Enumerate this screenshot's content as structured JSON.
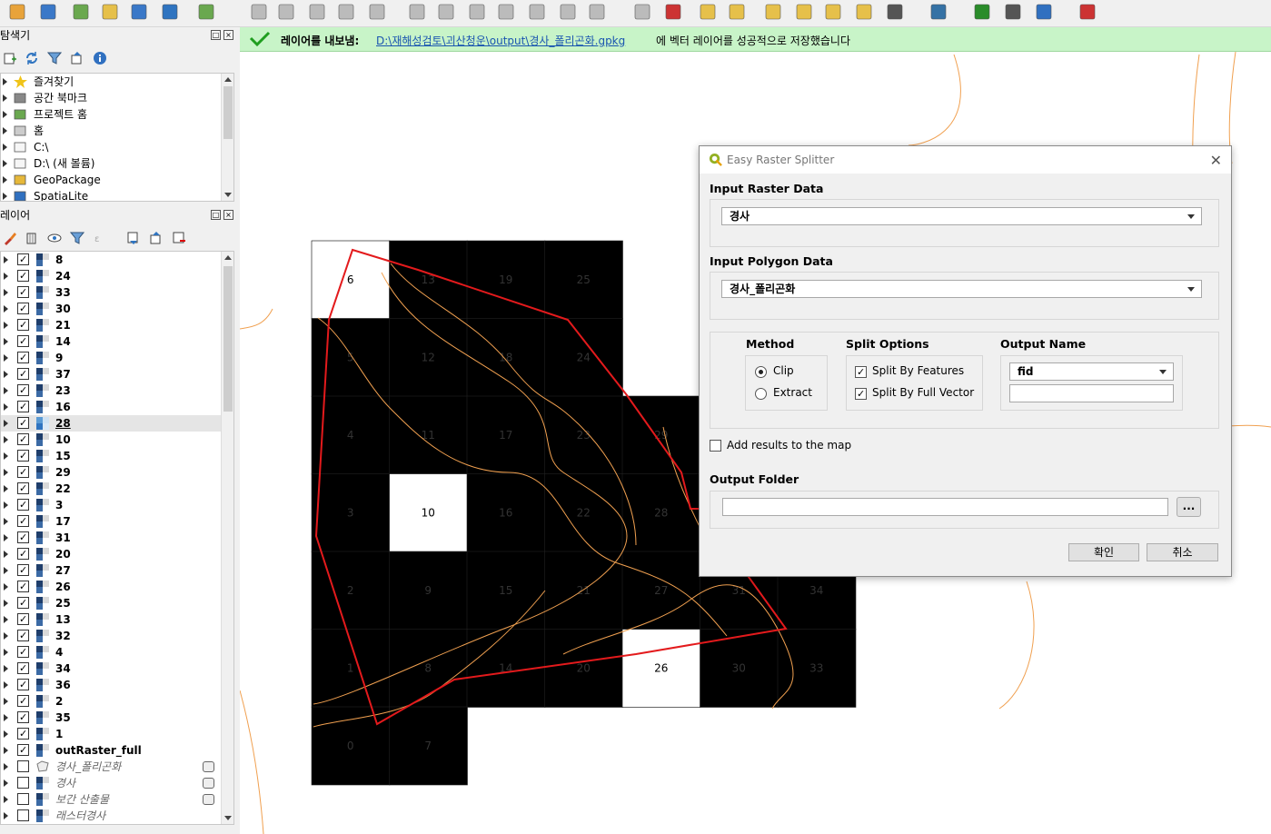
{
  "toolbar": {
    "icons": [
      "open-data-source-manager-icon",
      "new-geopackage-layer-icon",
      "new-shapefile-layer-icon",
      "digitize-icon",
      "new-spatialite-icon",
      "new-virtual-layer-icon",
      "vector-tools-icon",
      "edit-pencil-icon",
      "toggle-editing-icon",
      "save-edits-icon",
      "add-feature-icon",
      "vertex-tool-icon",
      "modify-attributes-icon",
      "delete-selected-icon",
      "cut-features-icon",
      "copy-features-icon",
      "paste-features-icon",
      "undo-icon",
      "redo-icon",
      "label-toolbar-icon",
      "label-pin-icon",
      "label-abc-icon",
      "label-highlight-icon",
      "label-show-icon",
      "label-move-icon",
      "label-rotate-icon",
      "label-change-icon",
      "plugin-globe-icon",
      "python-console-icon",
      "profile-tool-icon",
      "georeferencer-icon",
      "help-icon",
      "crosshair-icon"
    ]
  },
  "browser": {
    "title": "탐색기",
    "items": [
      {
        "label": "즐겨찾기",
        "icon": "star-icon"
      },
      {
        "label": "공간 북마크",
        "icon": "bookmark-icon"
      },
      {
        "label": "프로젝트 홈",
        "icon": "project-home-icon"
      },
      {
        "label": "홈",
        "icon": "home-folder-icon"
      },
      {
        "label": "C:\\",
        "icon": "drive-folder-icon"
      },
      {
        "label": "D:\\ (새 볼륨)",
        "icon": "drive-folder-icon"
      },
      {
        "label": "GeoPackage",
        "icon": "geopackage-icon"
      },
      {
        "label": "SpatiaLite",
        "icon": "spatialite-icon"
      }
    ]
  },
  "layers": {
    "title": "레이어",
    "items": [
      {
        "label": "8",
        "checked": true,
        "style": "raster"
      },
      {
        "label": "24",
        "checked": true,
        "style": "raster"
      },
      {
        "label": "33",
        "checked": true,
        "style": "raster"
      },
      {
        "label": "30",
        "checked": true,
        "style": "raster"
      },
      {
        "label": "21",
        "checked": true,
        "style": "raster"
      },
      {
        "label": "14",
        "checked": true,
        "style": "raster"
      },
      {
        "label": "9",
        "checked": true,
        "style": "raster"
      },
      {
        "label": "37",
        "checked": true,
        "style": "raster"
      },
      {
        "label": "23",
        "checked": true,
        "style": "raster"
      },
      {
        "label": "16",
        "checked": true,
        "style": "raster"
      },
      {
        "label": "28",
        "checked": true,
        "style": "raster",
        "selected": true
      },
      {
        "label": "10",
        "checked": true,
        "style": "raster"
      },
      {
        "label": "15",
        "checked": true,
        "style": "raster"
      },
      {
        "label": "29",
        "checked": true,
        "style": "raster"
      },
      {
        "label": "22",
        "checked": true,
        "style": "raster"
      },
      {
        "label": "3",
        "checked": true,
        "style": "raster"
      },
      {
        "label": "17",
        "checked": true,
        "style": "raster"
      },
      {
        "label": "31",
        "checked": true,
        "style": "raster"
      },
      {
        "label": "20",
        "checked": true,
        "style": "raster"
      },
      {
        "label": "27",
        "checked": true,
        "style": "raster"
      },
      {
        "label": "26",
        "checked": true,
        "style": "raster"
      },
      {
        "label": "25",
        "checked": true,
        "style": "raster"
      },
      {
        "label": "13",
        "checked": true,
        "style": "raster"
      },
      {
        "label": "32",
        "checked": true,
        "style": "raster"
      },
      {
        "label": "4",
        "checked": true,
        "style": "raster"
      },
      {
        "label": "34",
        "checked": true,
        "style": "raster"
      },
      {
        "label": "36",
        "checked": true,
        "style": "raster"
      },
      {
        "label": "2",
        "checked": true,
        "style": "raster"
      },
      {
        "label": "35",
        "checked": true,
        "style": "raster"
      },
      {
        "label": "1",
        "checked": true,
        "style": "raster"
      },
      {
        "label": "outRaster_full",
        "checked": true,
        "style": "raster"
      },
      {
        "label": "경사_폴리곤화",
        "checked": false,
        "style": "polygon-ital"
      },
      {
        "label": "경사",
        "checked": false,
        "style": "raster-ital"
      },
      {
        "label": "보간 산출물",
        "checked": false,
        "style": "raster-ital"
      },
      {
        "label": "래스터경사",
        "checked": false,
        "style": "raster-ital"
      }
    ]
  },
  "message": {
    "title": "레이어를 내보냄:",
    "path": "D:\\재해성검토\\괴산청운\\output\\경사_폴리곤화.gpkg",
    "rest": "에 벡터 레이어를 성공적으로 저장했습니다"
  },
  "map": {
    "white_cells": [
      "6",
      "10",
      "26"
    ],
    "cell_labels": [
      {
        "label": "6",
        "col": 0,
        "row": 0
      },
      {
        "label": "13",
        "col": 1,
        "row": 0
      },
      {
        "label": "19",
        "col": 2,
        "row": 0
      },
      {
        "label": "25",
        "col": 3,
        "row": 0
      },
      {
        "label": "5",
        "col": 0,
        "row": 1
      },
      {
        "label": "12",
        "col": 1,
        "row": 1
      },
      {
        "label": "18",
        "col": 2,
        "row": 1
      },
      {
        "label": "24",
        "col": 3,
        "row": 1
      },
      {
        "label": "4",
        "col": 0,
        "row": 2
      },
      {
        "label": "11",
        "col": 1,
        "row": 2
      },
      {
        "label": "17",
        "col": 2,
        "row": 2
      },
      {
        "label": "23",
        "col": 3,
        "row": 2
      },
      {
        "label": "29",
        "col": 4,
        "row": 2
      },
      {
        "label": "3",
        "col": 0,
        "row": 3
      },
      {
        "label": "10",
        "col": 1,
        "row": 3
      },
      {
        "label": "16",
        "col": 2,
        "row": 3
      },
      {
        "label": "22",
        "col": 3,
        "row": 3
      },
      {
        "label": "28",
        "col": 4,
        "row": 3
      },
      {
        "label": "2",
        "col": 0,
        "row": 4
      },
      {
        "label": "9",
        "col": 1,
        "row": 4
      },
      {
        "label": "15",
        "col": 2,
        "row": 4
      },
      {
        "label": "21",
        "col": 3,
        "row": 4
      },
      {
        "label": "27",
        "col": 4,
        "row": 4
      },
      {
        "label": "31",
        "col": 5,
        "row": 4
      },
      {
        "label": "34",
        "col": 6,
        "row": 4
      },
      {
        "label": "1",
        "col": 0,
        "row": 5
      },
      {
        "label": "8",
        "col": 1,
        "row": 5
      },
      {
        "label": "14",
        "col": 2,
        "row": 5
      },
      {
        "label": "20",
        "col": 3,
        "row": 5
      },
      {
        "label": "26",
        "col": 4,
        "row": 5
      },
      {
        "label": "30",
        "col": 5,
        "row": 5
      },
      {
        "label": "33",
        "col": 6,
        "row": 5
      },
      {
        "label": "0",
        "col": 0,
        "row": 6
      },
      {
        "label": "7",
        "col": 1,
        "row": 6
      }
    ],
    "colors": {
      "cell": "#000000",
      "white_cell": "#ffffff",
      "polygon": "#e31a1c",
      "contour": "#f0a050"
    }
  },
  "dialog": {
    "title": "Easy Raster Splitter",
    "input_raster_label": "Input Raster Data",
    "input_raster_value": "경사",
    "input_polygon_label": "Input Polygon Data",
    "input_polygon_value": "경사_폴리곤화",
    "method_label": "Method",
    "method_options": [
      {
        "label": "Clip",
        "selected": true
      },
      {
        "label": "Extract",
        "selected": false
      }
    ],
    "split_label": "Split Options",
    "split_options": [
      {
        "label": "Split By Features",
        "checked": true
      },
      {
        "label": "Split By Full Vector",
        "checked": true
      }
    ],
    "output_name_label": "Output Name",
    "output_name_value": "fid",
    "add_results_label": "Add results to the map",
    "add_results_checked": false,
    "output_folder_label": "Output Folder",
    "browse_label": "...",
    "ok_label": "확인",
    "cancel_label": "취소"
  }
}
